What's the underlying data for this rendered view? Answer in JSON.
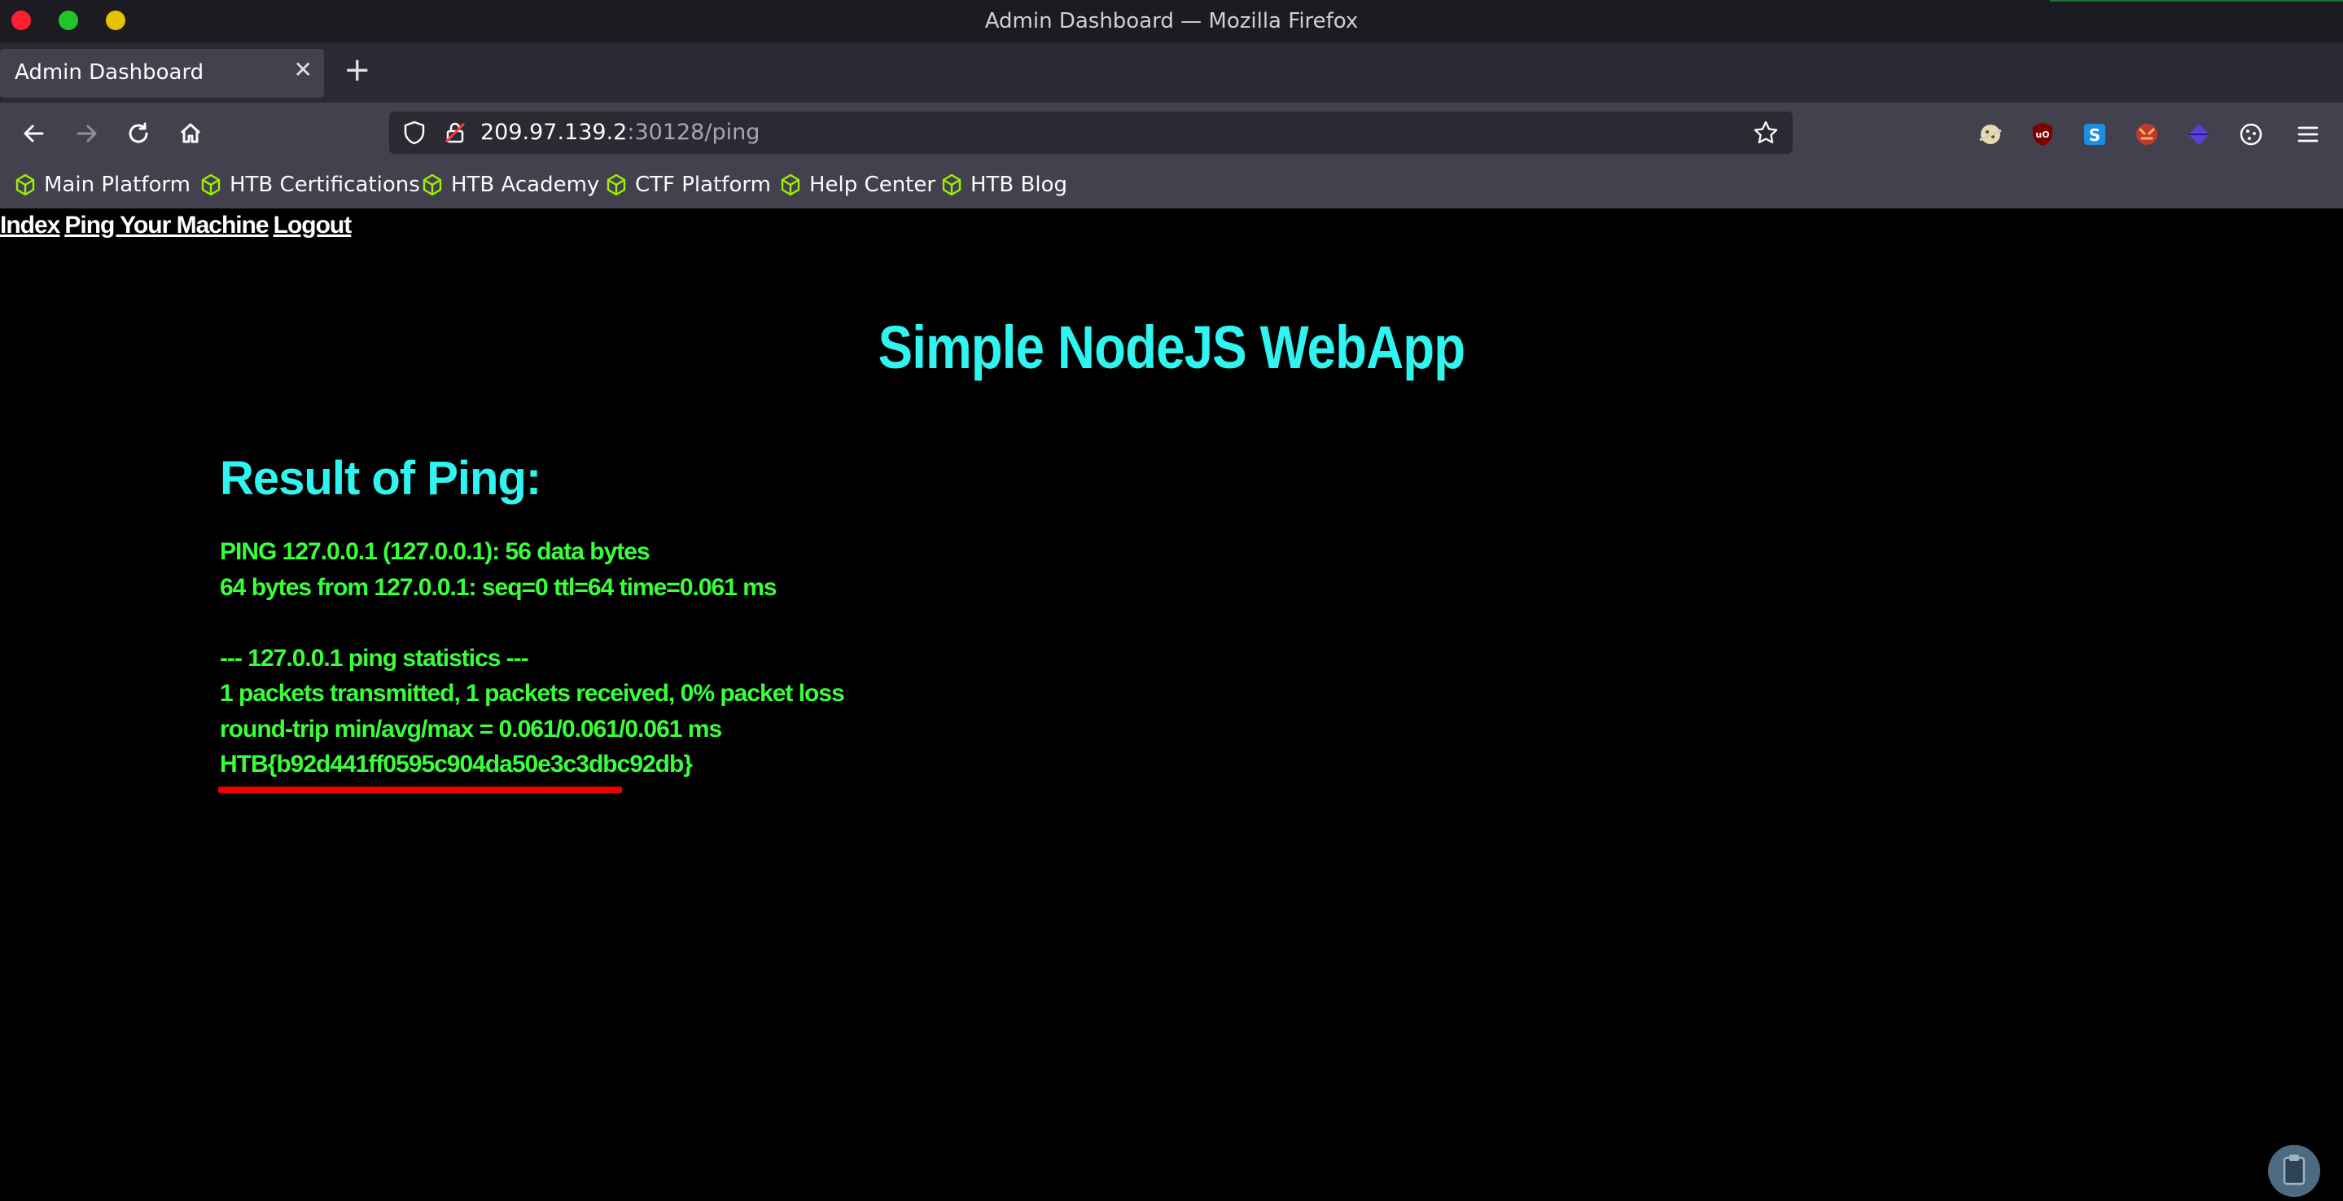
{
  "window": {
    "title": "Admin Dashboard — Mozilla Firefox"
  },
  "tabs": [
    {
      "label": "Admin Dashboard",
      "active": true
    }
  ],
  "urlbar": {
    "host": "209.97.139.2",
    "path": ":30128/ping"
  },
  "bookmarks": [
    {
      "label": "Main Platform"
    },
    {
      "label": "HTB Certifications"
    },
    {
      "label": "HTB Academy"
    },
    {
      "label": "CTF Platform"
    },
    {
      "label": "Help Center"
    },
    {
      "label": "HTB Blog"
    }
  ],
  "page": {
    "nav": [
      "Index",
      "Ping Your Machine",
      "Logout"
    ],
    "title": "Simple NodeJS WebApp",
    "result_heading": "Result of Ping:",
    "output_lines": [
      "PING 127.0.0.1 (127.0.0.1): 56 data bytes",
      "64 bytes from 127.0.0.1: seq=0 ttl=64 time=0.061 ms",
      "",
      "--- 127.0.0.1 ping statistics ---",
      "1 packets transmitted, 1 packets received, 0% packet loss",
      "round-trip min/avg/max = 0.061/0.061/0.061 ms",
      "HTB{b92d441ff0595c904da50e3c3dbc92db}"
    ]
  },
  "colors": {
    "heading": "#2ff4ef",
    "output": "#39ff3a",
    "highlight": "#ee0000",
    "background": "#000000",
    "chrome": "#42414d"
  },
  "icons": {
    "nav": [
      "back-arrow-icon",
      "forward-arrow-icon",
      "reload-icon",
      "home-icon"
    ],
    "extensions": [
      "cookie-extension-icon",
      "ublock-icon",
      "s-extension-icon",
      "fox-extension-icon",
      "diamond-extension-icon",
      "cookie-manager-icon",
      "menu-icon"
    ]
  }
}
